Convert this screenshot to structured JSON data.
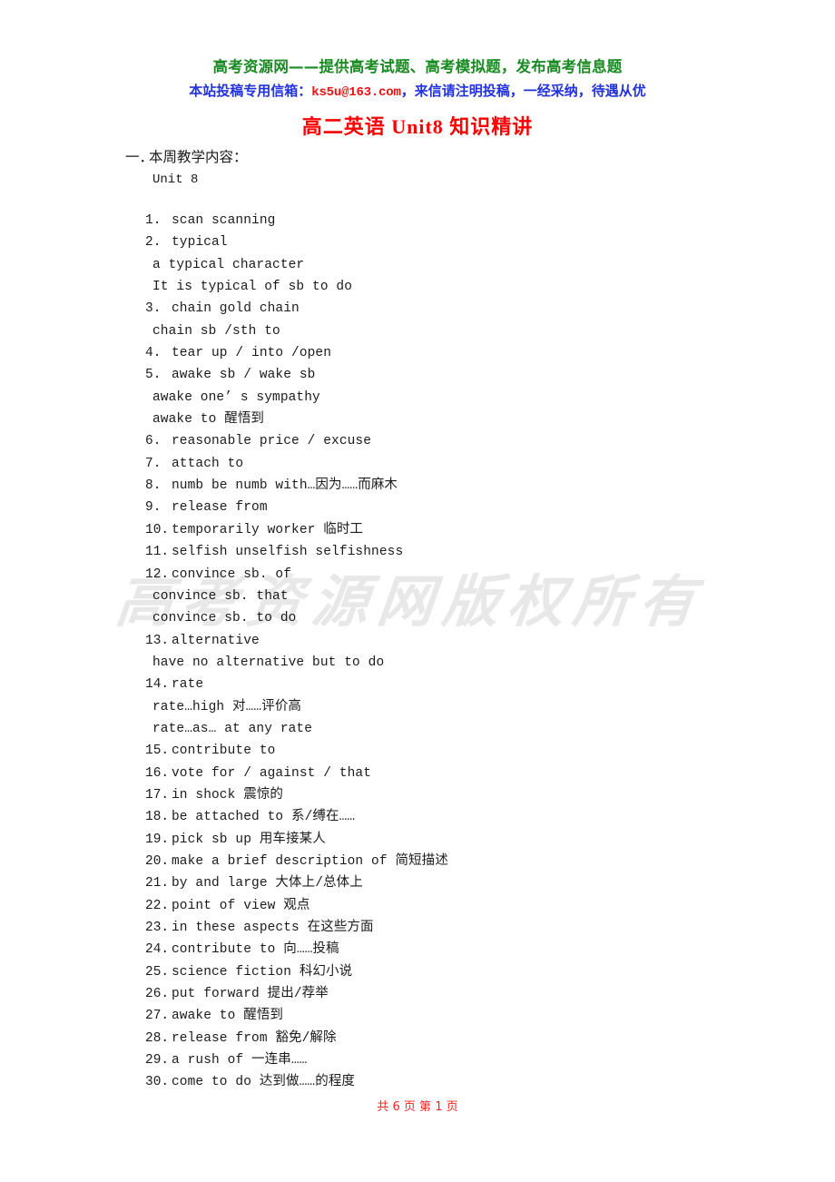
{
  "banner": {
    "line1": "高考资源网——提供高考试题、高考模拟题，发布高考信息题",
    "line2_prefix": "本站投稿专用信箱：",
    "email": "ks5u@163.com",
    "line2_suffix": "，来信请注明投稿，一经采纳，待遇从优",
    "color_line1": "#1a8a23",
    "color_line2": "#2233dd",
    "color_email": "#ee1111"
  },
  "title": {
    "text": "高二英语 Unit8 知识精讲",
    "color": "#ff0000"
  },
  "section": {
    "ordinal": "一．",
    "heading": "本周教学内容：",
    "sub": "Unit 8"
  },
  "items": [
    {
      "num": "1.",
      "text": "scan    scanning"
    },
    {
      "num": "2.",
      "text": "typical"
    },
    {
      "num": "",
      "sub": true,
      "text": "a typical character"
    },
    {
      "num": "",
      "sub": true,
      "text": "It is typical of sb to do"
    },
    {
      "num": "3.",
      "text": "chain   gold chain"
    },
    {
      "num": "",
      "sub": true,
      "text": "chain sb /sth to"
    },
    {
      "num": "4.",
      "text": "tear up / into /open"
    },
    {
      "num": "5.",
      "text": "awake sb / wake sb"
    },
    {
      "num": "",
      "sub": true,
      "text": "awake one’ s sympathy"
    },
    {
      "num": "",
      "sub": true,
      "text": "awake to 醒悟到"
    },
    {
      "num": "6.",
      "text": "reasonable price / excuse"
    },
    {
      "num": "7.",
      "text": "attach to"
    },
    {
      "num": "8.",
      "text": "numb   be numb with…因为……而麻木"
    },
    {
      "num": "9.",
      "text": "release from"
    },
    {
      "num": "10.",
      "text": "temporarily worker 临时工"
    },
    {
      "num": "11.",
      "text": "selfish  unselfish   selfishness"
    },
    {
      "num": "12.",
      "text": "convince sb. of"
    },
    {
      "num": "",
      "sub": true,
      "text": "convince sb. that"
    },
    {
      "num": "",
      "sub": true,
      "text": "convince sb. to do"
    },
    {
      "num": "13.",
      "text": "alternative"
    },
    {
      "num": "",
      "sub": true,
      "text": "have no alternative but to do"
    },
    {
      "num": "14.",
      "text": "rate"
    },
    {
      "num": "",
      "sub": true,
      "text": "rate…high 对……评价高"
    },
    {
      "num": "",
      "sub": true,
      "text": "rate…as…        at any rate"
    },
    {
      "num": "15.",
      "text": "contribute to"
    },
    {
      "num": "16.",
      "text": "vote for / against / that"
    },
    {
      "num": "17.",
      "text": "in shock 震惊的"
    },
    {
      "num": "18.",
      "text": "be attached to  系/缚在……"
    },
    {
      "num": "19.",
      "text": "pick sb up 用车接某人"
    },
    {
      "num": "20.",
      "text": "make a brief description of  简短描述"
    },
    {
      "num": "21.",
      "text": "by and large 大体上/总体上"
    },
    {
      "num": "22.",
      "text": "point of view 观点"
    },
    {
      "num": "23.",
      "text": "in these aspects 在这些方面"
    },
    {
      "num": "24.",
      "text": "contribute to 向……投稿"
    },
    {
      "num": "25.",
      "text": "science fiction 科幻小说"
    },
    {
      "num": "26.",
      "text": "put forward 提出/荐举"
    },
    {
      "num": "27.",
      "text": "awake to 醒悟到"
    },
    {
      "num": "28.",
      "text": "release from 豁免/解除"
    },
    {
      "num": "29.",
      "text": "a rush of 一连串……"
    },
    {
      "num": "30.",
      "text": "come to do 达到做……的程度"
    }
  ],
  "watermark": {
    "text": "高考资源网版权所有"
  },
  "footer": {
    "text": "共 6 页  第 1 页",
    "color": "#ff2222"
  }
}
